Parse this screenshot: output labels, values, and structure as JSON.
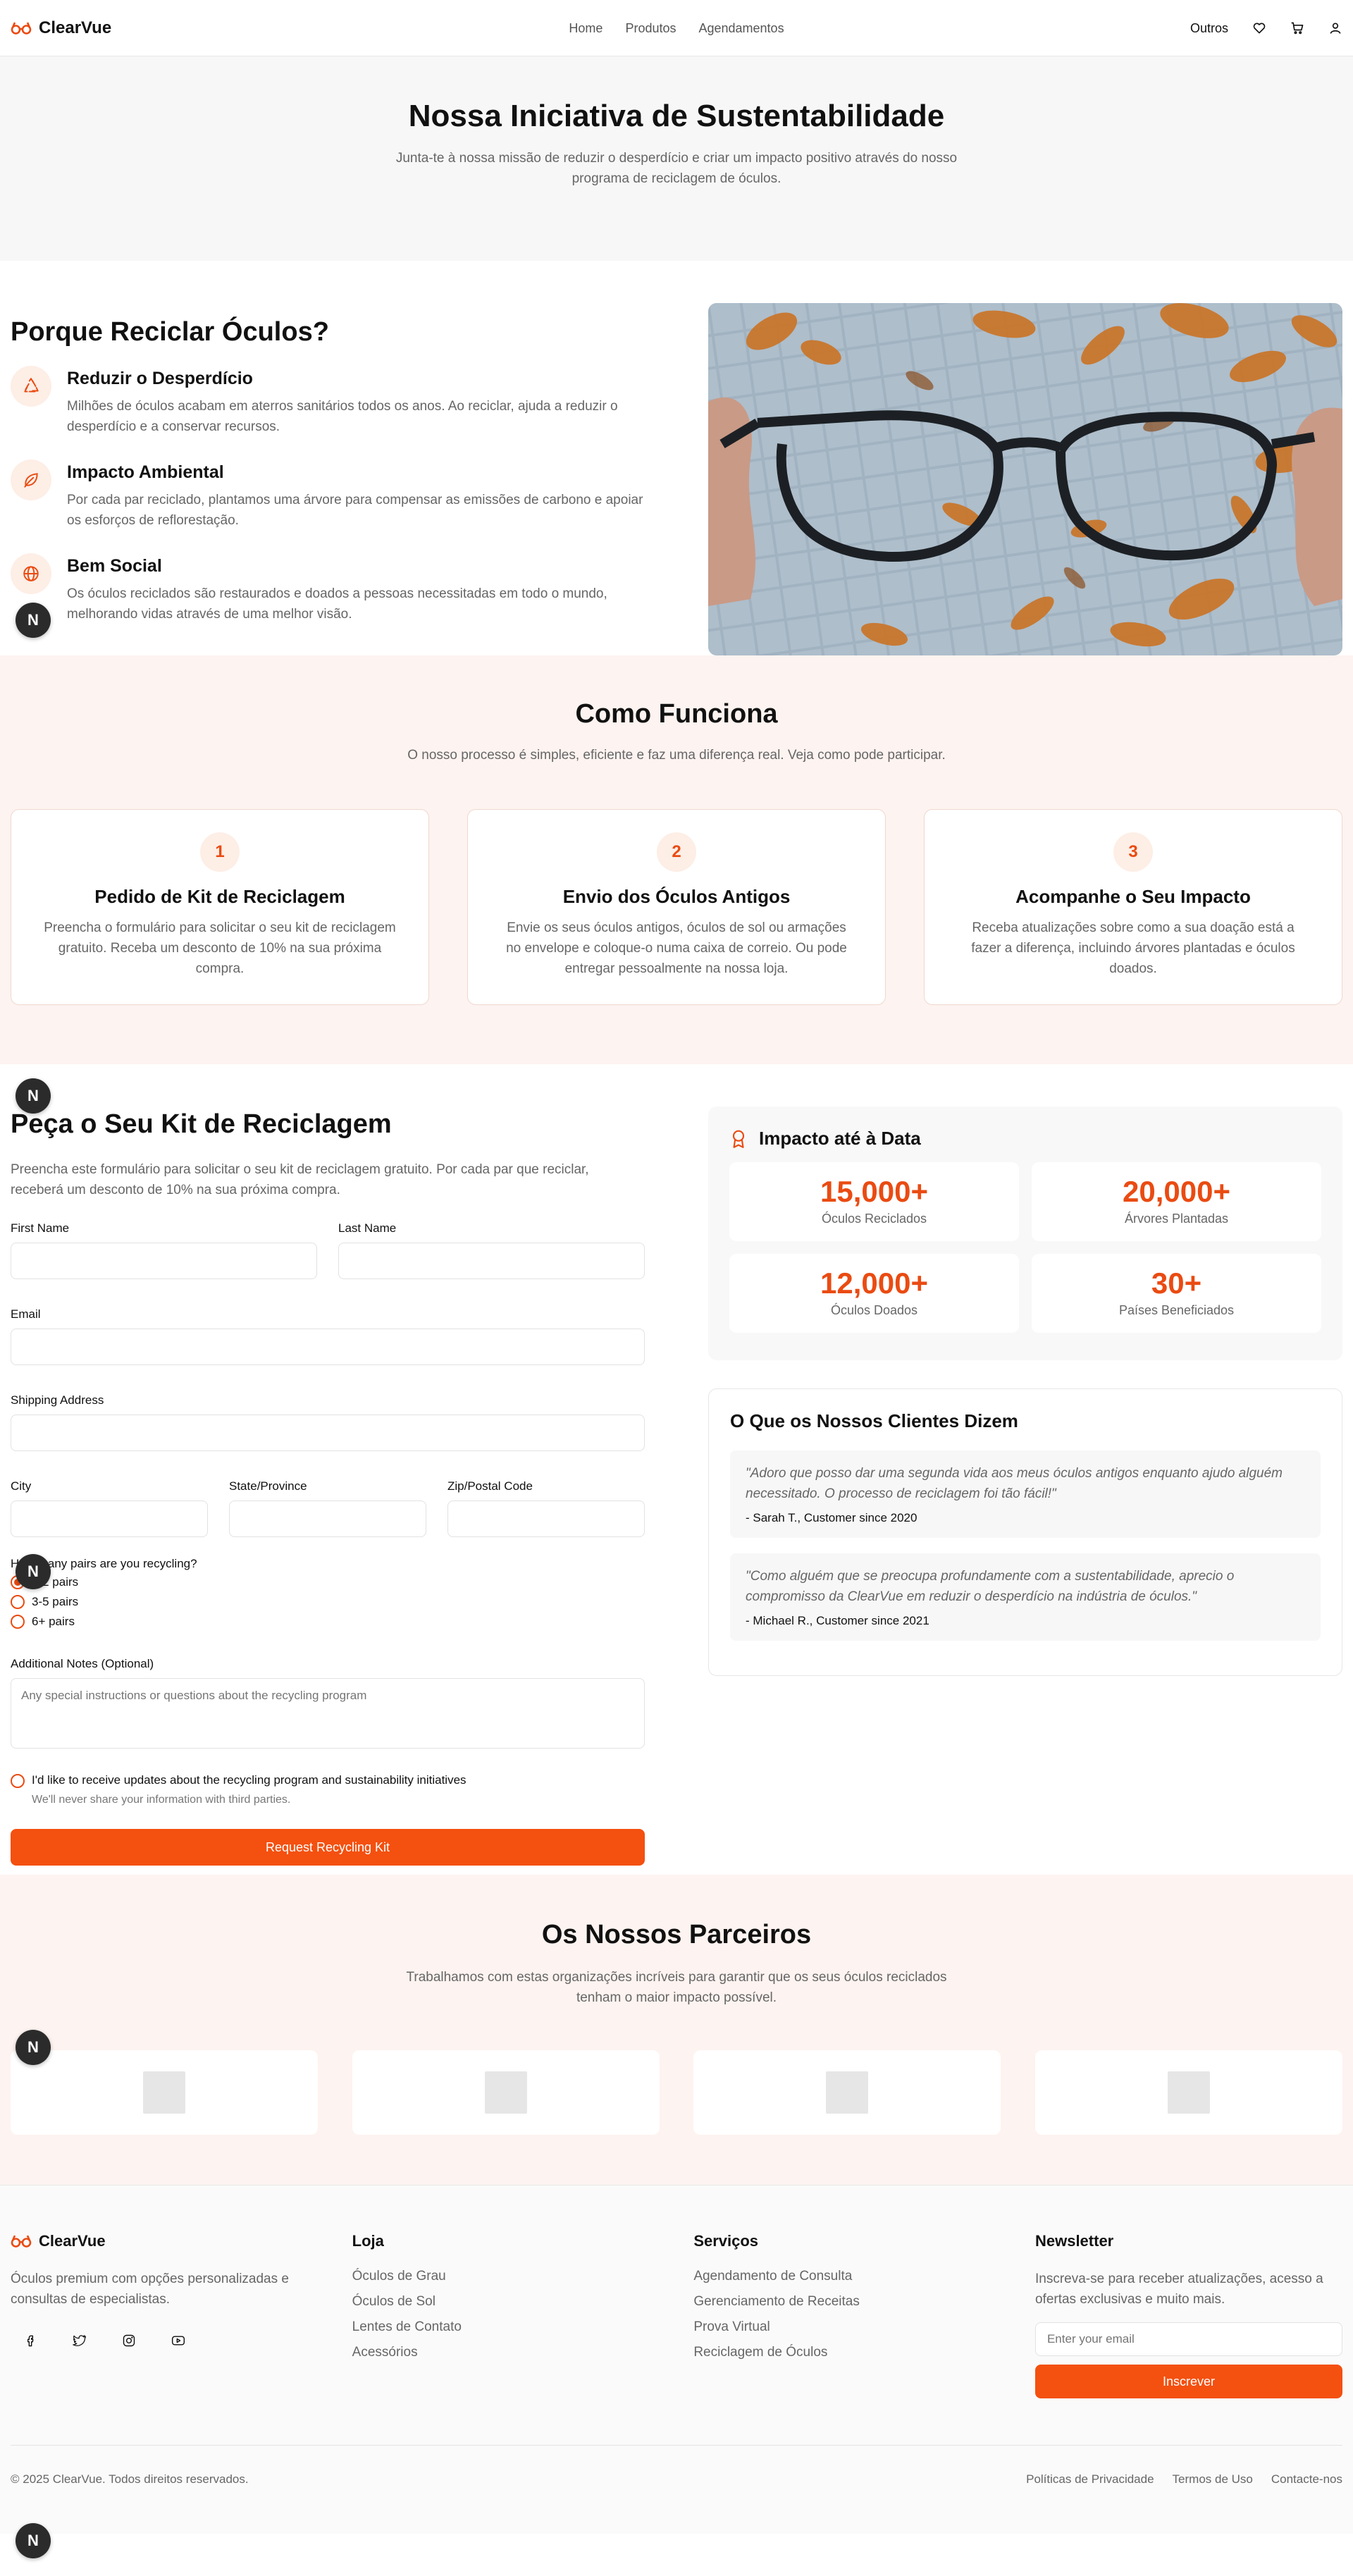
{
  "nav": {
    "brand": "ClearVue",
    "links": [
      "Home",
      "Produtos",
      "Agendamentos"
    ],
    "other": "Outros"
  },
  "hero": {
    "title": "Nossa Iniciativa de Sustentabilidade",
    "subtitle": "Junta-te à nossa missão de reduzir o desperdício e criar um impacto positivo através do nosso programa de reciclagem de óculos."
  },
  "why": {
    "title": "Porque Reciclar Óculos?",
    "features": [
      {
        "icon": "recycle-icon",
        "title": "Reduzir o Desperdício",
        "text": "Milhões de óculos acabam em aterros sanitários todos os anos. Ao reciclar, ajuda a reduzir o desperdício e a conservar recursos."
      },
      {
        "icon": "leaf-icon",
        "title": "Impacto Ambiental",
        "text": "Por cada par reciclado, plantamos uma árvore para compensar as emissões de carbono e apoiar os esforços de reflorestação."
      },
      {
        "icon": "globe-icon",
        "title": "Bem Social",
        "text": "Os óculos reciclados são restaurados e doados a pessoas necessitadas em todo o mundo, melhorando vidas através de uma melhor visão."
      }
    ]
  },
  "how": {
    "title": "Como Funciona",
    "subtitle": "O nosso processo é simples, eficiente e faz uma diferença real. Veja como pode participar.",
    "steps": [
      {
        "num": "1",
        "title": "Pedido de Kit de Reciclagem",
        "text": "Preencha o formulário para solicitar o seu kit de reciclagem gratuito. Receba um desconto de 10% na sua próxima compra."
      },
      {
        "num": "2",
        "title": "Envio dos Óculos Antigos",
        "text": "Envie os seus óculos antigos, óculos de sol ou armações no envelope e coloque-o numa caixa de correio. Ou pode entregar pessoalmente na nossa loja."
      },
      {
        "num": "3",
        "title": "Acompanhe o Seu Impacto",
        "text": "Receba atualizações sobre como a sua doação está a fazer a diferença, incluindo árvores plantadas e óculos doados."
      }
    ]
  },
  "kit": {
    "title": "Peça o Seu Kit de Reciclagem",
    "intro": "Preencha este formulário para solicitar o seu kit de reciclagem gratuito. Por cada par que reciclar, receberá um desconto de 10% na sua próxima compra.",
    "first_name": "First Name",
    "last_name": "Last Name",
    "email": "Email",
    "address": "Shipping Address",
    "city": "City",
    "state": "State/Province",
    "zip": "Zip/Postal Code",
    "pairs_q": "How many pairs are you recycling?",
    "pairs": [
      "1-2 pairs",
      "3-5 pairs",
      "6+ pairs"
    ],
    "notes_label": "Additional Notes (Optional)",
    "notes_placeholder": "Any special instructions or questions about the recycling program",
    "consent": "I'd like to receive updates about the recycling program and sustainability initiatives",
    "privacy": "We'll never share your information with third parties.",
    "submit": "Request Recycling Kit"
  },
  "impact": {
    "title": "Impacto até à Data",
    "stats": [
      {
        "n": "15,000+",
        "l": "Óculos Reciclados"
      },
      {
        "n": "20,000+",
        "l": "Árvores Plantadas"
      },
      {
        "n": "12,000+",
        "l": "Óculos Doados"
      },
      {
        "n": "30+",
        "l": "Países Beneficiados"
      }
    ]
  },
  "testimonials": {
    "title": "O Que os Nossos Clientes Dizem",
    "items": [
      {
        "q": "\"Adoro que posso dar uma segunda vida aos meus óculos antigos enquanto ajudo alguém necessitado. O processo de reciclagem foi tão fácil!\"",
        "a": "- Sarah T., Customer since 2020"
      },
      {
        "q": "\"Como alguém que se preocupa profundamente com a sustentabilidade, aprecio o compromisso da ClearVue em reduzir o desperdício na indústria de óculos.\"",
        "a": "- Michael R., Customer since 2021"
      }
    ]
  },
  "partners": {
    "title": "Os Nossos Parceiros",
    "subtitle": "Trabalhamos com estas organizações incríveis para garantir que os seus óculos reciclados tenham o maior impacto possível."
  },
  "footer": {
    "brand": "ClearVue",
    "about": "Óculos premium com opções personalizadas e consultas de especialistas.",
    "shop_title": "Loja",
    "shop": [
      "Óculos de Grau",
      "Óculos de Sol",
      "Lentes de Contato",
      "Acessórios"
    ],
    "services_title": "Serviços",
    "services": [
      "Agendamento de Consulta",
      "Gerenciamento de Receitas",
      "Prova Virtual",
      "Reciclagem de Óculos"
    ],
    "newsletter_title": "Newsletter",
    "newsletter_text": "Inscreva-se para receber atualizações, acesso a ofertas exclusivas e muito mais.",
    "email_placeholder": "Enter your email",
    "subscribe": "Inscrever",
    "copyright": "© 2025 ClearVue. Todos direitos reservados.",
    "legal": [
      "Políticas de Privacidade",
      "Termos de Uso",
      "Contacte-nos"
    ]
  },
  "colors": {
    "accent": "#f4500f",
    "accent_soft": "#fdeee6",
    "section_tint": "#fdf3f0"
  },
  "badge": "N"
}
